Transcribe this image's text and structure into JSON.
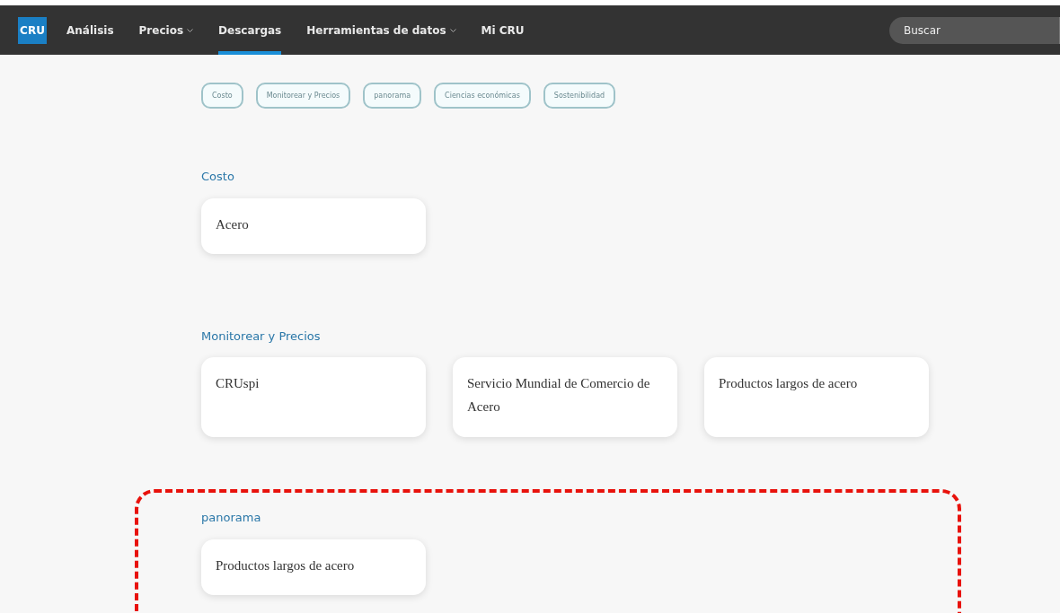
{
  "nav": {
    "logo": "CRU",
    "items": [
      {
        "label": "Análisis",
        "dropdown": false,
        "selected": false
      },
      {
        "label": "Precios",
        "dropdown": true,
        "selected": false
      },
      {
        "label": "Descargas",
        "dropdown": false,
        "selected": true
      },
      {
        "label": "Herramientas de datos",
        "dropdown": true,
        "selected": false
      },
      {
        "label": "Mi CRU",
        "dropdown": false,
        "selected": false
      }
    ],
    "search": {
      "placeholder": "Buscar"
    }
  },
  "filters": [
    "Costo",
    "Monitorear y Precios",
    "panorama",
    "Ciencias económicas",
    "Sostenibilidad"
  ],
  "sections": [
    {
      "title": "Costo",
      "highlighted": false,
      "cards": [
        "Acero"
      ]
    },
    {
      "title": "Monitorear y Precios",
      "highlighted": false,
      "cards": [
        "CRUspi",
        "Servicio Mundial de Comercio de Acero",
        "Productos largos de acero"
      ]
    },
    {
      "title": "panorama",
      "highlighted": true,
      "cards": [
        "Productos largos de acero"
      ]
    }
  ]
}
